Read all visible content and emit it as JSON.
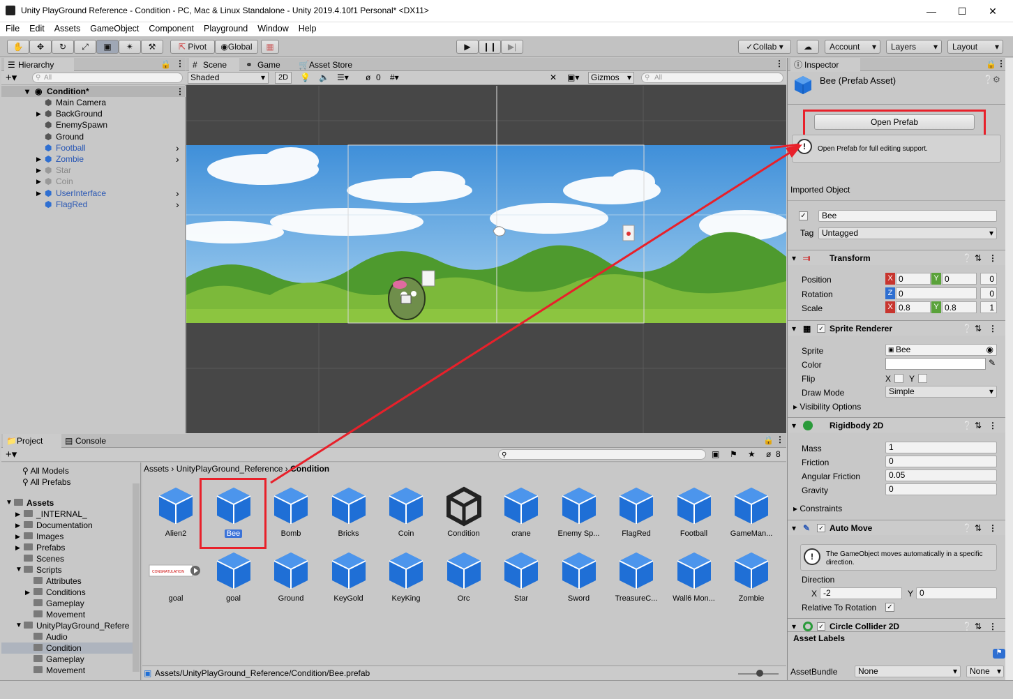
{
  "window": {
    "title": "Unity PlayGround Reference - Condition - PC, Mac & Linux Standalone - Unity 2019.4.10f1 Personal* <DX11>"
  },
  "menu": [
    "File",
    "Edit",
    "Assets",
    "GameObject",
    "Component",
    "Playground",
    "Window",
    "Help"
  ],
  "toolbar": {
    "pivot": "Pivot",
    "global": "Global",
    "collab": "Collab",
    "account": "Account",
    "layers": "Layers",
    "layout": "Layout"
  },
  "hierarchy": {
    "tab": "Hierarchy",
    "search_placeholder": "All",
    "scene": "Condition*",
    "items": [
      {
        "label": "Main Camera",
        "style": "normal",
        "arrow": false,
        "chevron": false
      },
      {
        "label": "BackGround",
        "style": "normal",
        "arrow": true,
        "chevron": false
      },
      {
        "label": "EnemySpawn",
        "style": "normal",
        "arrow": false,
        "chevron": false
      },
      {
        "label": "Ground",
        "style": "normal",
        "arrow": false,
        "chevron": false
      },
      {
        "label": "Football",
        "style": "blue",
        "arrow": false,
        "chevron": true
      },
      {
        "label": "Zombie",
        "style": "blue",
        "arrow": true,
        "chevron": true
      },
      {
        "label": "Star",
        "style": "grey",
        "arrow": true,
        "chevron": false
      },
      {
        "label": "Coin",
        "style": "grey",
        "arrow": true,
        "chevron": false
      },
      {
        "label": "UserInterface",
        "style": "blue",
        "arrow": true,
        "chevron": true
      },
      {
        "label": "FlagRed",
        "style": "blue",
        "arrow": false,
        "chevron": true
      }
    ]
  },
  "scene": {
    "tabs": [
      "Scene",
      "Game",
      "Asset Store"
    ],
    "shading": "Shaded",
    "mode2d": "2D",
    "hidden_count": "0",
    "gizmos": "Gizmos",
    "search_placeholder": "All"
  },
  "project": {
    "tabs": [
      "Project",
      "Console"
    ],
    "hidden_count": "8",
    "favorites": [
      "All Models",
      "All Prefabs"
    ],
    "tree": [
      {
        "label": "Assets",
        "indent": 0,
        "bold": true,
        "arrow": "open"
      },
      {
        "label": "_INTERNAL_",
        "indent": 1,
        "arrow": "closed"
      },
      {
        "label": "Documentation",
        "indent": 1,
        "arrow": "closed"
      },
      {
        "label": "Images",
        "indent": 1,
        "arrow": "closed"
      },
      {
        "label": "Prefabs",
        "indent": 1,
        "arrow": "closed"
      },
      {
        "label": "Scenes",
        "indent": 1,
        "arrow": "none"
      },
      {
        "label": "Scripts",
        "indent": 1,
        "arrow": "open"
      },
      {
        "label": "Attributes",
        "indent": 2,
        "arrow": "none"
      },
      {
        "label": "Conditions",
        "indent": 2,
        "arrow": "closed"
      },
      {
        "label": "Gameplay",
        "indent": 2,
        "arrow": "none"
      },
      {
        "label": "Movement",
        "indent": 2,
        "arrow": "none"
      },
      {
        "label": "UnityPlayGround_Refere",
        "indent": 1,
        "arrow": "open"
      },
      {
        "label": "Audio",
        "indent": 2,
        "arrow": "none"
      },
      {
        "label": "Condition",
        "indent": 2,
        "arrow": "none",
        "selected": true
      },
      {
        "label": "Gameplay",
        "indent": 2,
        "arrow": "none"
      },
      {
        "label": "Movement",
        "indent": 2,
        "arrow": "none"
      }
    ],
    "breadcrumb": [
      "Assets",
      "UnityPlayGround_Reference",
      "Condition"
    ],
    "assets_row1": [
      "Alien2",
      "Bee",
      "Bomb",
      "Bricks",
      "Coin",
      "Condition",
      "crane",
      "Enemy Sp...",
      "FlagRed",
      "Football",
      "GameMan..."
    ],
    "assets_row2": [
      "goal",
      "goal",
      "Ground",
      "KeyGold",
      "KeyKing",
      "Orc",
      "Star",
      "Sword",
      "TreasureC...",
      "Wall6 Mon...",
      "Zombie"
    ],
    "congrats_text": "CONGRATULATION",
    "footer_path": "Assets/UnityPlayGround_Reference/Condition/Bee.prefab"
  },
  "inspector": {
    "tab": "Inspector",
    "title": "Bee (Prefab Asset)",
    "open_prefab": "Open Prefab",
    "open_prefab_hint": "Open Prefab for full editing support.",
    "imported_object": "Imported Object",
    "name": "Bee",
    "tag_label": "Tag",
    "tag_value": "Untagged",
    "transform": {
      "title": "Transform",
      "rows": [
        {
          "label": "Position",
          "x": "0",
          "y": "0",
          "z": "0"
        },
        {
          "label": "Rotation",
          "x": "",
          "y": "",
          "z": "0",
          "xval": "0"
        },
        {
          "label": "Scale",
          "x": "0.8",
          "y": "0.8",
          "z": "1"
        }
      ]
    },
    "sprite_renderer": {
      "title": "Sprite Renderer",
      "sprite_label": "Sprite",
      "sprite": "Bee",
      "color_label": "Color",
      "flip_label": "Flip",
      "flip_x": "X",
      "flip_y": "Y",
      "draw_mode_label": "Draw Mode",
      "draw_mode": "Simple",
      "visibility": "Visibility Options"
    },
    "rigidbody": {
      "title": "Rigidbody 2D",
      "rows": [
        {
          "label": "Mass",
          "value": "1"
        },
        {
          "label": "Friction",
          "value": "0"
        },
        {
          "label": "Angular Friction",
          "value": "0.05"
        },
        {
          "label": "Gravity",
          "value": "0"
        }
      ],
      "constraints": "Constraints"
    },
    "auto_move": {
      "title": "Auto Move",
      "info": "The GameObject moves automatically in a specific direction.",
      "direction_label": "Direction",
      "x": "-2",
      "y": "0",
      "relative_label": "Relative To Rotation"
    },
    "circle_collider": {
      "title": "Circle Collider 2D"
    },
    "asset_labels": "Asset Labels",
    "assetbundle_label": "AssetBundle",
    "assetbundle": "None",
    "variant": "None"
  },
  "colors": {
    "highlight_red": "#e8202a",
    "cube_blue": "#1f6fd6",
    "selection": "#3a72d8"
  }
}
